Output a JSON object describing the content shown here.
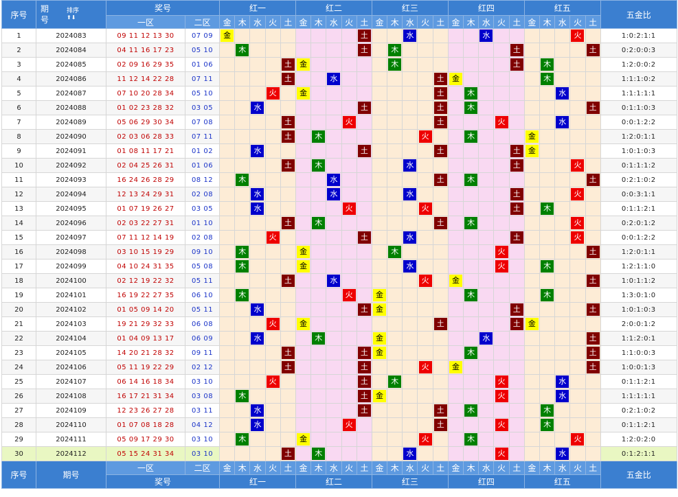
{
  "header": {
    "seq": "序号",
    "period": "期号",
    "period_line1": "期",
    "period_line2": "号",
    "sort": "排序",
    "prize": "奖号",
    "zone1": "一区",
    "zone2": "二区",
    "groups": [
      "红一",
      "红二",
      "红三",
      "红四",
      "红五"
    ],
    "elements": [
      "金",
      "木",
      "水",
      "火",
      "土"
    ],
    "ratio": "五金比"
  },
  "colors": {
    "header_bg": "#3b7fd0",
    "gold": "#ffff00",
    "wood": "#008000",
    "water": "#0000cc",
    "fire": "#ee0000",
    "earth": "#800000",
    "zone1_text": "#c00000",
    "zone2_text": "#1a33c8"
  },
  "rows": [
    {
      "seq": "1",
      "period": "2024083",
      "z1": "09 11 12 13 30",
      "z2": "07 09",
      "marks": [
        "金",
        "土",
        "水",
        "水",
        "火"
      ],
      "ratio": "1:0:2:1:1"
    },
    {
      "seq": "2",
      "period": "2024084",
      "z1": "04 11 16 17 23",
      "z2": "05 10",
      "marks": [
        "木",
        "土",
        "木",
        "土",
        "土"
      ],
      "ratio": "0:2:0:0:3"
    },
    {
      "seq": "3",
      "period": "2024085",
      "z1": "02 09 16 29 35",
      "z2": "01 06",
      "marks": [
        "土",
        "金",
        "木",
        "土",
        "木"
      ],
      "ratio": "1:2:0:0:2"
    },
    {
      "seq": "4",
      "period": "2024086",
      "z1": "11 12 14 22 28",
      "z2": "07 11",
      "marks": [
        "土",
        "水",
        "土",
        "金",
        "木"
      ],
      "ratio": "1:1:1:0:2"
    },
    {
      "seq": "5",
      "period": "2024087",
      "z1": "07 10 20 28 34",
      "z2": "05 10",
      "marks": [
        "火",
        "金",
        "土",
        "木",
        "水"
      ],
      "ratio": "1:1:1:1:1"
    },
    {
      "seq": "6",
      "period": "2024088",
      "z1": "01 02 23 28 32",
      "z2": "03 05",
      "marks": [
        "水",
        "土",
        "土",
        "木",
        "土"
      ],
      "ratio": "0:1:1:0:3"
    },
    {
      "seq": "7",
      "period": "2024089",
      "z1": "05 06 29 30 34",
      "z2": "07 08",
      "marks": [
        "土",
        "火",
        "土",
        "火",
        "水"
      ],
      "ratio": "0:0:1:2:2"
    },
    {
      "seq": "8",
      "period": "2024090",
      "z1": "02 03 06 28 33",
      "z2": "07 11",
      "marks": [
        "土",
        "木",
        "火",
        "木",
        "金"
      ],
      "ratio": "1:2:0:1:1"
    },
    {
      "seq": "9",
      "period": "2024091",
      "z1": "01 08 11 17 21",
      "z2": "01 02",
      "marks": [
        "水",
        "土",
        "土",
        "土",
        "金"
      ],
      "ratio": "1:0:1:0:3"
    },
    {
      "seq": "10",
      "period": "2024092",
      "z1": "02 04 25 26 31",
      "z2": "01 06",
      "marks": [
        "土",
        "木",
        "水",
        "土",
        "火"
      ],
      "ratio": "0:1:1:1:2"
    },
    {
      "seq": "11",
      "period": "2024093",
      "z1": "16 24 26 28 29",
      "z2": "08 12",
      "marks": [
        "木",
        "水",
        "土",
        "木",
        "土"
      ],
      "ratio": "0:2:1:0:2"
    },
    {
      "seq": "12",
      "period": "2024094",
      "z1": "12 13 24 29 31",
      "z2": "02 08",
      "marks": [
        "水",
        "水",
        "水",
        "土",
        "火"
      ],
      "ratio": "0:0:3:1:1"
    },
    {
      "seq": "13",
      "period": "2024095",
      "z1": "01 07 19 26 27",
      "z2": "03 05",
      "marks": [
        "水",
        "火",
        "火",
        "土",
        "木"
      ],
      "ratio": "0:1:1:2:1"
    },
    {
      "seq": "14",
      "period": "2024096",
      "z1": "02 03 22 27 31",
      "z2": "01 10",
      "marks": [
        "土",
        "木",
        "土",
        "木",
        "火"
      ],
      "ratio": "0:2:0:1:2"
    },
    {
      "seq": "15",
      "period": "2024097",
      "z1": "07 11 12 14 19",
      "z2": "02 08",
      "marks": [
        "火",
        "土",
        "水",
        "土",
        "火"
      ],
      "ratio": "0:0:1:2:2"
    },
    {
      "seq": "16",
      "period": "2024098",
      "z1": "03 10 15 19 29",
      "z2": "09 10",
      "marks": [
        "木",
        "金",
        "木",
        "火",
        "土"
      ],
      "ratio": "1:2:0:1:1"
    },
    {
      "seq": "17",
      "period": "2024099",
      "z1": "04 10 24 31 35",
      "z2": "05 08",
      "marks": [
        "木",
        "金",
        "水",
        "火",
        "木"
      ],
      "ratio": "1:2:1:1:0"
    },
    {
      "seq": "18",
      "period": "2024100",
      "z1": "02 12 19 22 32",
      "z2": "05 11",
      "marks": [
        "土",
        "水",
        "火",
        "金",
        "土"
      ],
      "ratio": "1:0:1:1:2"
    },
    {
      "seq": "19",
      "period": "2024101",
      "z1": "16 19 22 27 35",
      "z2": "06 10",
      "marks": [
        "木",
        "火",
        "金",
        "木",
        "木"
      ],
      "ratio": "1:3:0:1:0"
    },
    {
      "seq": "20",
      "period": "2024102",
      "z1": "01 05 09 14 20",
      "z2": "05 11",
      "marks": [
        "水",
        "土",
        "金",
        "土",
        "土"
      ],
      "ratio": "1:0:1:0:3"
    },
    {
      "seq": "21",
      "period": "2024103",
      "z1": "19 21 29 32 33",
      "z2": "06 08",
      "marks": [
        "火",
        "金",
        "土",
        "土",
        "金"
      ],
      "ratio": "2:0:0:1:2"
    },
    {
      "seq": "22",
      "period": "2024104",
      "z1": "01 04 09 13 17",
      "z2": "06 09",
      "marks": [
        "水",
        "木",
        "金",
        "水",
        "土"
      ],
      "ratio": "1:1:2:0:1"
    },
    {
      "seq": "23",
      "period": "2024105",
      "z1": "14 20 21 28 32",
      "z2": "09 11",
      "marks": [
        "土",
        "土",
        "金",
        "木",
        "土"
      ],
      "ratio": "1:1:0:0:3"
    },
    {
      "seq": "24",
      "period": "2024106",
      "z1": "05 11 19 22 29",
      "z2": "02 12",
      "marks": [
        "土",
        "土",
        "火",
        "金",
        "土"
      ],
      "ratio": "1:0:0:1:3"
    },
    {
      "seq": "25",
      "period": "2024107",
      "z1": "06 14 16 18 34",
      "z2": "03 10",
      "marks": [
        "火",
        "土",
        "木",
        "火",
        "水"
      ],
      "ratio": "0:1:1:2:1"
    },
    {
      "seq": "26",
      "period": "2024108",
      "z1": "16 17 21 31 34",
      "z2": "03 08",
      "marks": [
        "木",
        "土",
        "金",
        "火",
        "水"
      ],
      "ratio": "1:1:1:1:1"
    },
    {
      "seq": "27",
      "period": "2024109",
      "z1": "12 23 26 27 28",
      "z2": "03 11",
      "marks": [
        "水",
        "土",
        "土",
        "木",
        "木"
      ],
      "ratio": "0:2:1:0:2"
    },
    {
      "seq": "28",
      "period": "2024110",
      "z1": "01 07 08 18 28",
      "z2": "04 12",
      "marks": [
        "水",
        "火",
        "土",
        "火",
        "木"
      ],
      "ratio": "0:1:1:2:1"
    },
    {
      "seq": "29",
      "period": "2024111",
      "z1": "05 09 17 29 30",
      "z2": "03 10",
      "marks": [
        "木",
        "金",
        "火",
        "木",
        "火"
      ],
      "ratio": "1:2:0:2:0"
    },
    {
      "seq": "30",
      "period": "2024112",
      "z1": "05 15 24 31 34",
      "z2": "03 10",
      "marks": [
        "土",
        "木",
        "水",
        "火",
        "水"
      ],
      "ratio": "0:1:2:1:1"
    }
  ]
}
